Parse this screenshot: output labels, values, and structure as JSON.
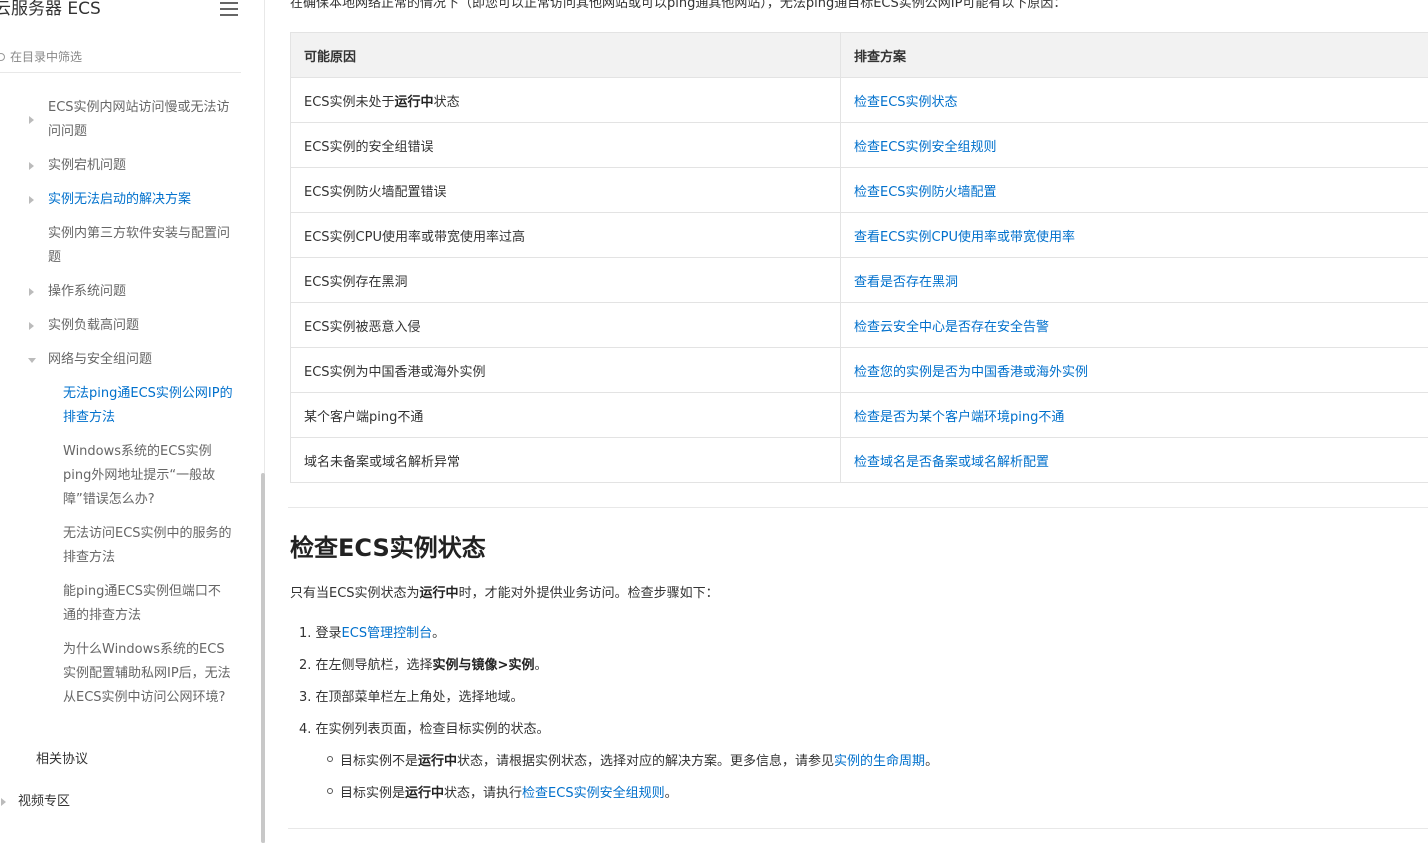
{
  "sidebar": {
    "title": "云服务器 ECS",
    "filter_placeholder": "在目录中筛选",
    "items": [
      {
        "label": "ECS实例内网站访问慢或无法访问问题"
      },
      {
        "label": "实例宕机问题"
      },
      {
        "label": "实例无法启动的解决方案"
      },
      {
        "label": "实例内第三方软件安装与配置问题"
      },
      {
        "label": "操作系统问题"
      },
      {
        "label": "实例负载高问题"
      },
      {
        "label": "网络与安全组问题"
      },
      {
        "label": "无法ping通ECS实例公网IP的排查方法"
      },
      {
        "label": "Windows系统的ECS实例ping外网地址提示“一般故障”错误怎么办?"
      },
      {
        "label": "无法访问ECS实例中的服务的排查方法"
      },
      {
        "label": "能ping通ECS实例但端口不通的排查方法"
      },
      {
        "label": "为什么Windows系统的ECS实例配置辅助私网IP后，无法从ECS实例中访问公网环境?"
      },
      {
        "label": "相关协议"
      },
      {
        "label": "视频专区"
      }
    ]
  },
  "main": {
    "intro": "在确保本地网络正常的情况下（即您可以正常访问其他网站或可以ping通其他网站），无法ping通目标ECS实例公网IP可能有以下原因：",
    "table": {
      "headers": [
        "可能原因",
        "排查方案"
      ],
      "rows": [
        {
          "cause_pre": "ECS实例未处于",
          "cause_bold": "运行中",
          "cause_post": "状态",
          "solution": "检查ECS实例状态"
        },
        {
          "cause_pre": "ECS实例的安全组错误",
          "cause_bold": "",
          "cause_post": "",
          "solution": "检查ECS实例安全组规则"
        },
        {
          "cause_pre": "ECS实例防火墙配置错误",
          "cause_bold": "",
          "cause_post": "",
          "solution": "检查ECS实例防火墙配置"
        },
        {
          "cause_pre": "ECS实例CPU使用率或带宽使用率过高",
          "cause_bold": "",
          "cause_post": "",
          "solution": "查看ECS实例CPU使用率或带宽使用率"
        },
        {
          "cause_pre": "ECS实例存在黑洞",
          "cause_bold": "",
          "cause_post": "",
          "solution": "查看是否存在黑洞"
        },
        {
          "cause_pre": "ECS实例被恶意入侵",
          "cause_bold": "",
          "cause_post": "",
          "solution": "检查云安全中心是否存在安全告警"
        },
        {
          "cause_pre": "ECS实例为中国香港或海外实例",
          "cause_bold": "",
          "cause_post": "",
          "solution": "检查您的实例是否为中国香港或海外实例"
        },
        {
          "cause_pre": "某个客户端ping不通",
          "cause_bold": "",
          "cause_post": "",
          "solution": "检查是否为某个客户端环境ping不通"
        },
        {
          "cause_pre": "域名未备案或域名解析异常",
          "cause_bold": "",
          "cause_post": "",
          "solution": "检查域名是否备案或域名解析配置"
        }
      ]
    },
    "section": {
      "title": "检查ECS实例状态",
      "para_pre": "只有当ECS实例状态为",
      "para_bold": "运行中",
      "para_post": "时，才能对外提供业务访问。检查步骤如下：",
      "steps": {
        "s1_pre": "1. 登录",
        "s1_link": "ECS管理控制台",
        "s1_post": "。",
        "s2_pre": "2. 在左侧导航栏，选择",
        "s2_bold": "实例与镜像>实例",
        "s2_post": "。",
        "s3": "3. 在顶部菜单栏左上角处，选择地域。",
        "s4": "4. 在实例列表页面，检查目标实例的状态。"
      },
      "sub_steps": {
        "a_pre": "目标实例不是",
        "a_bold": "运行中",
        "a_mid": "状态，请根据实例状态，选择对应的解决方案。更多信息，请参见",
        "a_link": "实例的生命周期",
        "a_post": "。",
        "b_pre": "目标实例是",
        "b_bold": "运行中",
        "b_mid": "状态，请执行",
        "b_link": "检查ECS实例安全组规则",
        "b_post": "。"
      }
    }
  },
  "colors": {
    "link": "#0070cc",
    "text": "#333333",
    "header_bg": "#f2f2f2",
    "border": "#e3e3e3"
  }
}
